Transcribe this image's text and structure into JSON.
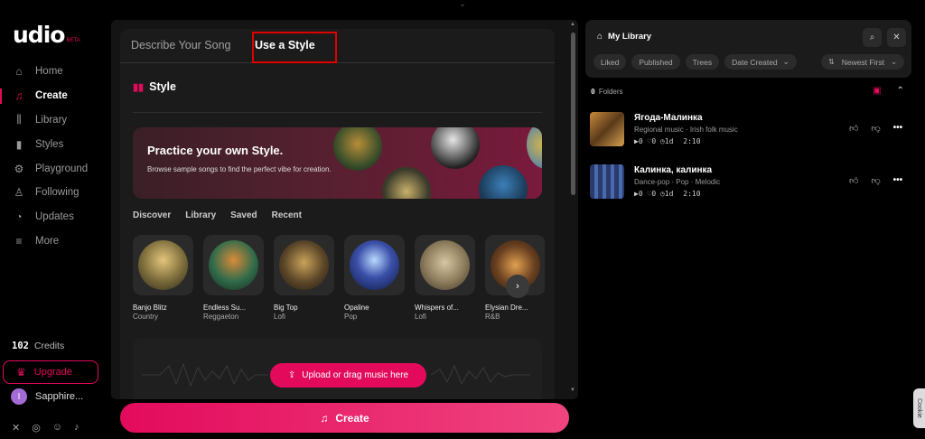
{
  "app": {
    "logo": "udio",
    "logo_badge": "BETA"
  },
  "sidebar": {
    "items": [
      {
        "label": "Home",
        "icon": "home-icon"
      },
      {
        "label": "Create",
        "icon": "music-note-icon",
        "active": true
      },
      {
        "label": "Library",
        "icon": "library-icon"
      },
      {
        "label": "Styles",
        "icon": "waveform-icon"
      },
      {
        "label": "Playground",
        "icon": "playground-icon"
      },
      {
        "label": "Following",
        "icon": "user-icon"
      },
      {
        "label": "Updates",
        "icon": "bell-icon"
      },
      {
        "label": "More",
        "icon": "menu-icon"
      }
    ],
    "credits_count": "102",
    "credits_label": "Credits",
    "upgrade_label": "Upgrade",
    "user": {
      "initial": "I",
      "name": "Sapphire..."
    }
  },
  "create_panel": {
    "tabs": [
      "Describe Your Song",
      "Use a Style"
    ],
    "active_tab": "Use a Style",
    "section_title": "Style",
    "practice": {
      "title": "Practice your own Style.",
      "description": "Browse sample songs to find the perfect vibe for creation."
    },
    "subtabs": [
      "Discover",
      "Library",
      "Saved",
      "Recent"
    ],
    "styles": [
      {
        "title": "Banjo Blitz",
        "genre": "Country"
      },
      {
        "title": "Endless Su...",
        "genre": "Reggaeton"
      },
      {
        "title": "Big Top",
        "genre": "Lofi"
      },
      {
        "title": "Opaline",
        "genre": "Pop"
      },
      {
        "title": "Whispers of...",
        "genre": "Lofi"
      },
      {
        "title": "Elysian Dre...",
        "genre": "R&B"
      }
    ],
    "upload_label": "Upload or drag music here",
    "create_label": "Create"
  },
  "library": {
    "title": "My Library",
    "filters": [
      "Liked",
      "Published",
      "Trees",
      "Date Created"
    ],
    "sort_label": "Newest First",
    "folders_count": "0",
    "folders_label": "Folders",
    "songs": [
      {
        "title": "Ягода-Малинка",
        "tags": [
          "Regional music",
          "Irish folk music"
        ],
        "plays": "0",
        "likes": "0",
        "age": "1d",
        "duration": "2:10"
      },
      {
        "title": "Калинка, калинка",
        "tags": [
          "Dance-pop",
          "Pop",
          "Melodic"
        ],
        "plays": "0",
        "likes": "0",
        "age": "1d",
        "duration": "2:10"
      }
    ]
  },
  "cookie_label": "Cookie",
  "colors": {
    "accent": "#e30a5c",
    "background": "#000000",
    "panel": "#1b1b1b",
    "highlight_box": "#e00000"
  }
}
